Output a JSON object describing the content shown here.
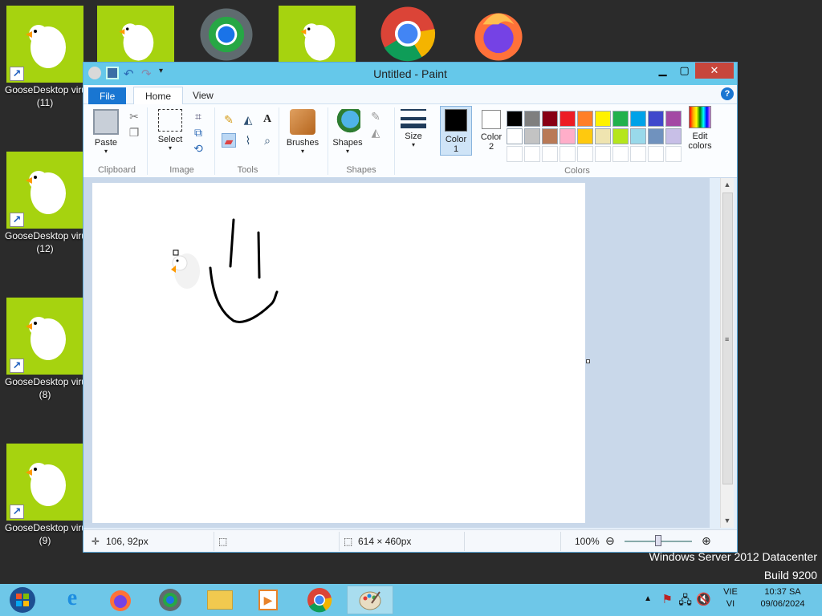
{
  "desktop": {
    "icons": [
      {
        "label": "GooseDesktop viru",
        "sub": "(11)"
      },
      {
        "label": "GooseDesktop viru",
        "sub": "(12)"
      },
      {
        "label": "GooseDesktop viru",
        "sub": "(8)"
      },
      {
        "label": "GooseDesktop viru",
        "sub": "(9)"
      }
    ],
    "watermark_line1": "Windows Server 2012 Datacenter",
    "watermark_line2": "Build 9200"
  },
  "window": {
    "title": "Untitled - Paint",
    "tabs": {
      "file": "File",
      "home": "Home",
      "view": "View"
    },
    "help": "?",
    "ribbon": {
      "clipboard": {
        "paste": "Paste",
        "group": "Clipboard"
      },
      "image": {
        "select": "Select",
        "group": "Image"
      },
      "tools": {
        "group": "Tools"
      },
      "brushes": "Brushes",
      "shapes": {
        "label": "Shapes",
        "group": "Shapes"
      },
      "size": "Size",
      "color1": {
        "label": "Color",
        "num": "1"
      },
      "color2": {
        "label": "Color",
        "num": "2"
      },
      "edit_colors": {
        "line1": "Edit",
        "line2": "colors"
      },
      "colors_group": "Colors",
      "palette_row1": [
        "#000000",
        "#7f7f7f",
        "#880015",
        "#ed1c24",
        "#ff7f27",
        "#fff200",
        "#22b14c",
        "#00a2e8",
        "#3f48cc",
        "#a349a4"
      ],
      "palette_row2": [
        "#ffffff",
        "#c3c3c3",
        "#b97a57",
        "#ffaec9",
        "#ffc90e",
        "#efe4b0",
        "#b5e61d",
        "#99d9ea",
        "#7092be",
        "#c8bfe7"
      ],
      "palette_row3": [
        "#ffffff",
        "#ffffff",
        "#ffffff",
        "#ffffff",
        "#ffffff",
        "#ffffff",
        "#ffffff",
        "#ffffff",
        "#ffffff",
        "#ffffff"
      ],
      "color1_value": "#000000",
      "color2_value": "#ffffff"
    },
    "status": {
      "cursor_pos": "106, 92px",
      "canvas_size": "614 × 460px",
      "zoom": "100%"
    }
  },
  "taskbar": {
    "items": [
      "start",
      "internet-explorer",
      "firefox",
      "chrome-beta",
      "file-explorer",
      "media-player",
      "chrome",
      "paint"
    ],
    "tray": {
      "lang1": "VIE",
      "lang2": "VI",
      "time": "10:37 SA",
      "date": "09/06/2024"
    }
  }
}
